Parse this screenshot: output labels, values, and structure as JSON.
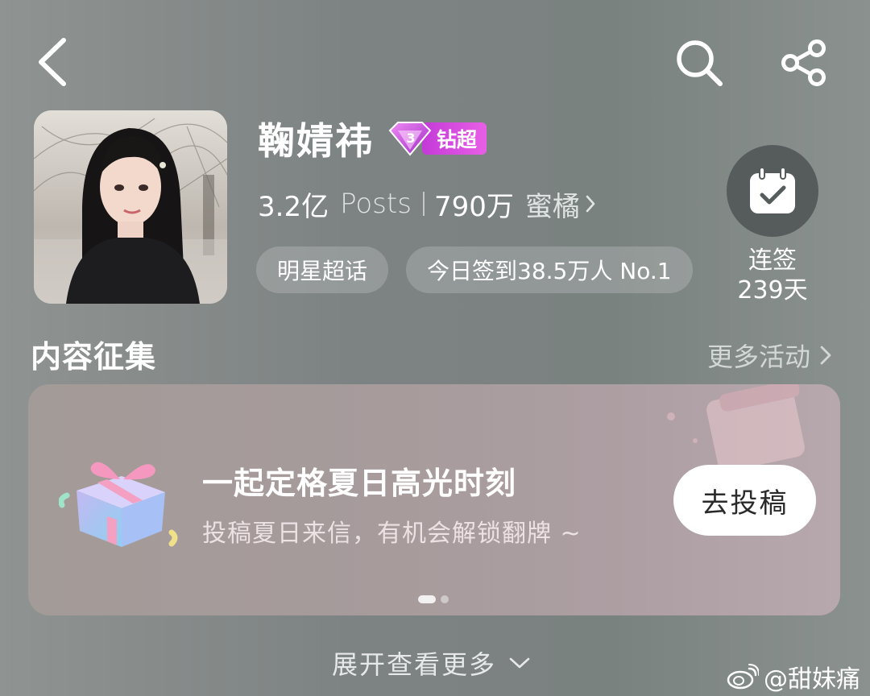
{
  "header": {
    "back_icon": "chevron-left-icon",
    "search_icon": "search-icon",
    "share_icon": "share-icon"
  },
  "profile": {
    "name": "鞠婧祎",
    "badge_level": "3",
    "badge_label": "钻超",
    "posts_count": "3.2亿",
    "posts_label": "Posts",
    "fans_count": "790万",
    "fans_label": "蜜橘",
    "chips": [
      "明星超话",
      "今日签到38.5万人 No.1"
    ]
  },
  "checkin": {
    "label": "连签",
    "days": "239天"
  },
  "section": {
    "title": "内容征集",
    "more_label": "更多活动"
  },
  "banner": {
    "title": "一起定格夏日高光时刻",
    "subtitle": "投稿夏日来信，有机会解锁翻牌 ~",
    "button_label": "去投稿",
    "pages": 2,
    "active_page": 1
  },
  "footer": {
    "expand_label": "展开查看更多",
    "watermark": "@甜妹痛"
  },
  "colors": {
    "badge_gradient_start": "#c43ad8",
    "badge_gradient_end": "#e85fe6",
    "checkin_circle": "#565c5b"
  }
}
